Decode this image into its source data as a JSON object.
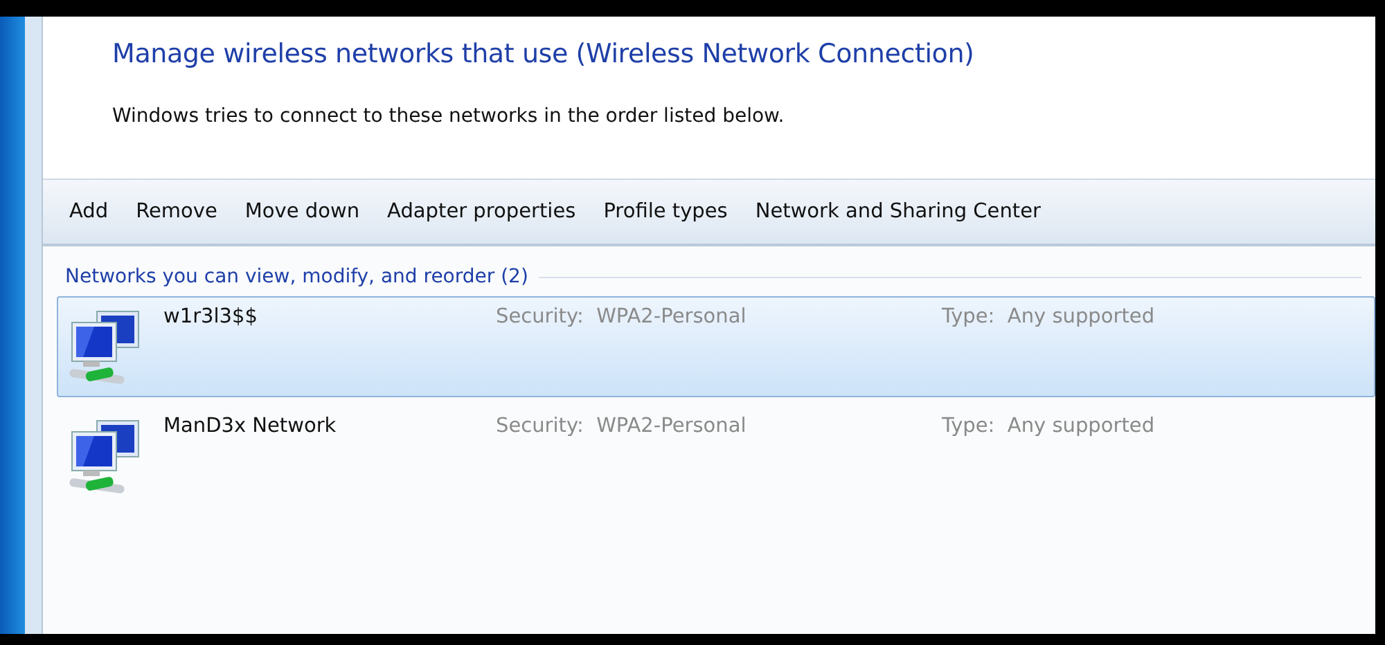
{
  "title": "Manage wireless networks that use (Wireless Network Connection)",
  "description": "Windows tries to connect to these networks in the order listed below.",
  "toolbar": [
    "Add",
    "Remove",
    "Move down",
    "Adapter properties",
    "Profile types",
    "Network and Sharing Center"
  ],
  "group": {
    "label": "Networks you can view, modify, and reorder (2)"
  },
  "networks": [
    {
      "name": "w1r3l3$$",
      "security_label": "Security:",
      "security": "WPA2-Personal",
      "type_label": "Type:",
      "type": "Any supported",
      "selected": true
    },
    {
      "name": "ManD3x Network",
      "security_label": "Security:",
      "security": "WPA2-Personal",
      "type_label": "Type:",
      "type": "Any supported",
      "selected": false
    }
  ]
}
